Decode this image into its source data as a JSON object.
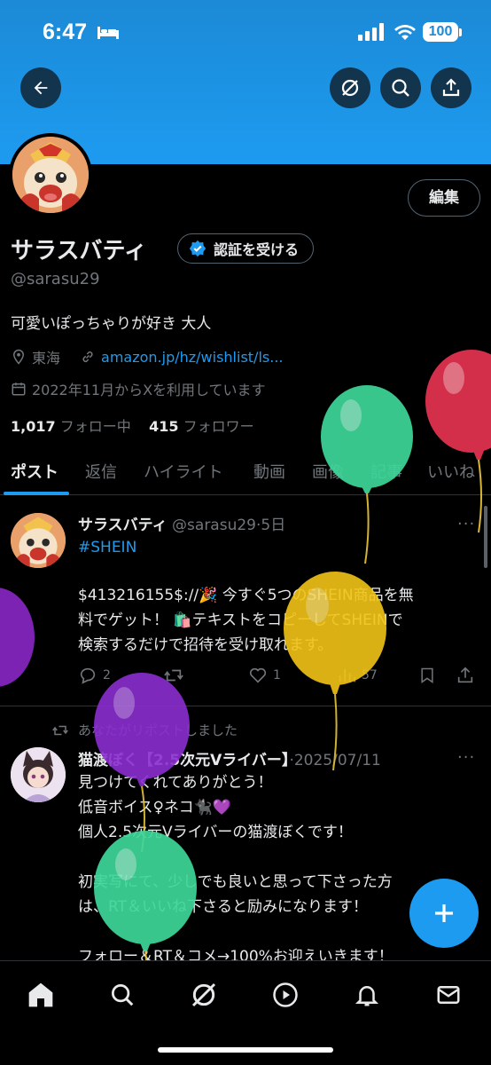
{
  "status_bar": {
    "time": "6:47",
    "battery": "100"
  },
  "profile": {
    "edit_label": "編集",
    "name": "サラスバティ",
    "verify_label": "認証を受ける",
    "handle": "@sarasu29",
    "bio": "可愛いぽっちゃりが好き 大人",
    "location": "東海",
    "link": "amazon.jp/hz/wishlist/ls...",
    "joined": "2022年11月からXを利用しています",
    "following_count": "1,017",
    "following_label": "フォロー中",
    "followers_count": "415",
    "followers_label": "フォロワー"
  },
  "tabs": [
    "ポスト",
    "返信",
    "ハイライト",
    "動画",
    "画像",
    "記事",
    "いいね"
  ],
  "post1": {
    "name": "サラスバティ",
    "handle": "@sarasu29",
    "dot": "·",
    "time": "5日",
    "hashtag": "#SHEIN",
    "line1": "$413216155$://🎉 今すぐ5つのSHEIN商品を無",
    "line2": "料でゲット！ 🛍️テキストをコピーしてSHEINで",
    "line3": "検索するだけで招待を受け取れます。",
    "replies": "2",
    "likes": "1",
    "views": "57"
  },
  "post2": {
    "repost_label": "あなたがリポストしました",
    "name": "猫渡ぼく【2.5次元Vライバー】",
    "dot": "·",
    "time": "2025/07/11",
    "line1": "見つけてくれてありがとう！",
    "line2": "低音ボイス♀ネコ🐈‍⬛💜",
    "line3": "個人2.5次元Vライバーの猫渡ぼくです！",
    "line4": "初実写にて、少しでも良いと思って下さった方",
    "line5": "は、RT＆いいね下さると励みになります！",
    "line6": "フォロー＆RT＆コメ→100%お迎えいきます！"
  },
  "colors": {
    "accent": "#1d9bf0",
    "banner": "#1d9bf0",
    "background": "#000000"
  },
  "icons": [
    "back-arrow-icon",
    "grok-icon",
    "search-icon",
    "share-icon",
    "verified-badge-icon",
    "location-icon",
    "link-icon",
    "calendar-icon",
    "reply-icon",
    "repost-icon",
    "like-icon",
    "views-icon",
    "bookmark-icon",
    "plus-icon",
    "home-icon",
    "play-icon",
    "bell-icon",
    "mail-icon"
  ]
}
